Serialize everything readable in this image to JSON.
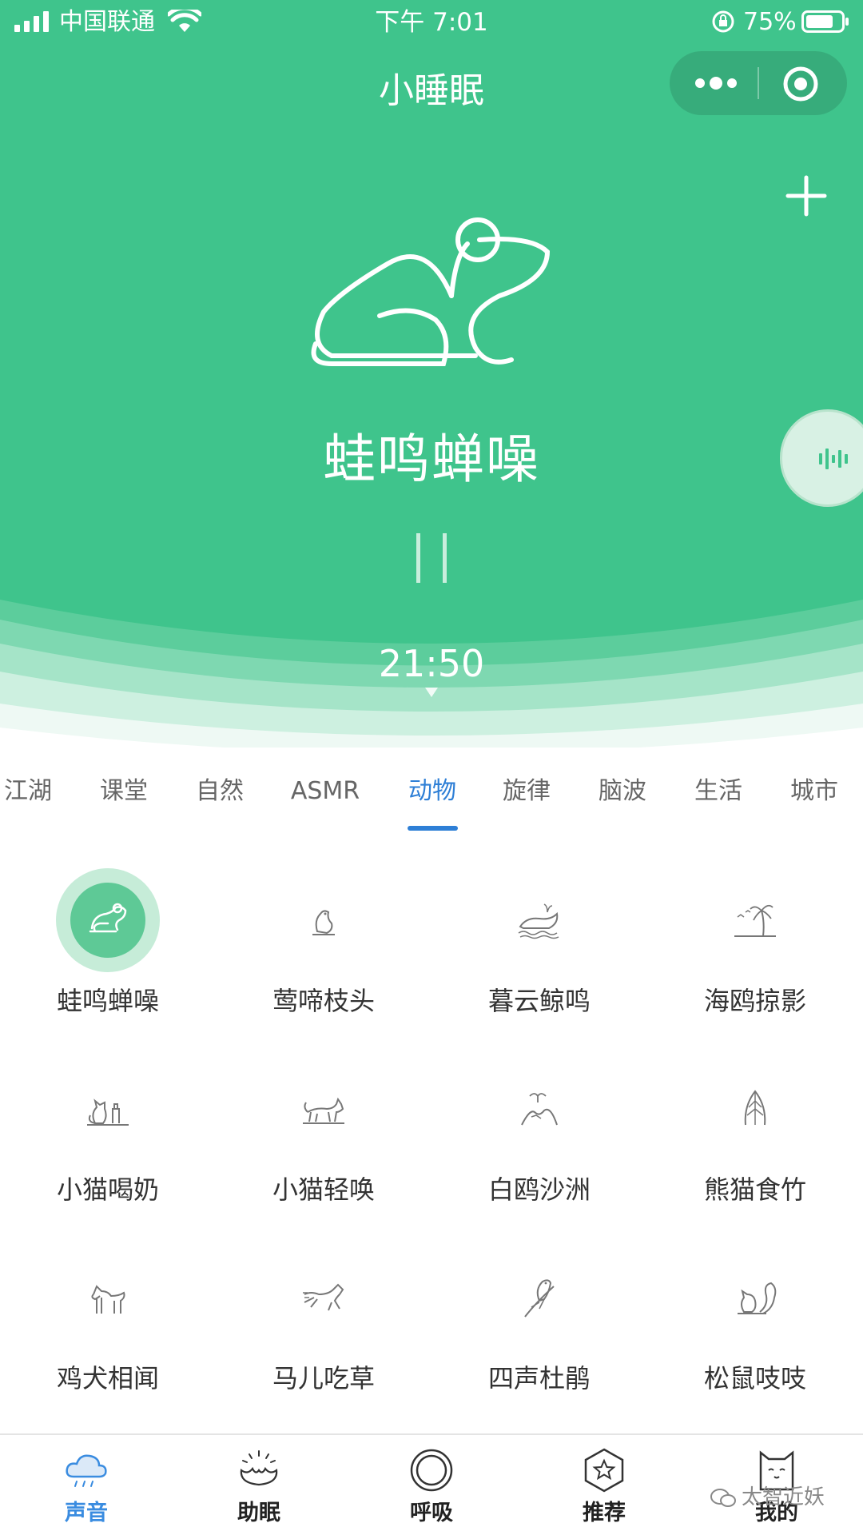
{
  "status_bar": {
    "carrier": "中国联通",
    "time": "下午 7:01",
    "battery": "75%"
  },
  "header": {
    "title": "小睡眠",
    "more_icon": "more-dots-icon",
    "close_icon": "target-close-icon",
    "add_icon": "plus-icon"
  },
  "player": {
    "sound_name": "蛙鸣蝉噪",
    "art_icon": "frog-icon",
    "state_icon": "pause-icon",
    "timer": "21:50",
    "side_icon": "sound-wave-icon"
  },
  "tabs": {
    "items": [
      "江湖",
      "课堂",
      "自然",
      "ASMR",
      "动物",
      "旋律",
      "脑波",
      "生活",
      "城市"
    ],
    "active_index": 4
  },
  "sounds": [
    {
      "label": "蛙鸣蝉噪",
      "icon": "frog-icon",
      "active": true
    },
    {
      "label": "莺啼枝头",
      "icon": "songbird-icon",
      "active": false
    },
    {
      "label": "暮云鲸鸣",
      "icon": "whale-icon",
      "active": false
    },
    {
      "label": "海鸥掠影",
      "icon": "palm-seagull-icon",
      "active": false
    },
    {
      "label": "小猫喝奶",
      "icon": "cat-milk-icon",
      "active": false
    },
    {
      "label": "小猫轻唤",
      "icon": "cat-walking-icon",
      "active": false
    },
    {
      "label": "白鸥沙洲",
      "icon": "gull-sandbar-icon",
      "active": false
    },
    {
      "label": "熊猫食竹",
      "icon": "bamboo-icon",
      "active": false
    },
    {
      "label": "鸡犬相闻",
      "icon": "dog-icon",
      "active": false
    },
    {
      "label": "马儿吃草",
      "icon": "horse-icon",
      "active": false
    },
    {
      "label": "四声杜鹃",
      "icon": "cuckoo-icon",
      "active": false
    },
    {
      "label": "松鼠吱吱",
      "icon": "squirrel-icon",
      "active": false
    }
  ],
  "bottom_nav": {
    "items": [
      {
        "label": "声音",
        "icon": "cloud-rain-icon",
        "active": true
      },
      {
        "label": "助眠",
        "icon": "lotus-icon",
        "active": false
      },
      {
        "label": "呼吸",
        "icon": "breath-circle-icon",
        "active": false
      },
      {
        "label": "推荐",
        "icon": "star-hexagon-icon",
        "active": false
      },
      {
        "label": "我的",
        "icon": "cat-face-icon",
        "active": false
      }
    ]
  },
  "watermark": "太智近妖",
  "colors": {
    "primary_green": "#3fc48c",
    "tab_active": "#2e7fd6",
    "nav_active": "#3a8ce0"
  }
}
